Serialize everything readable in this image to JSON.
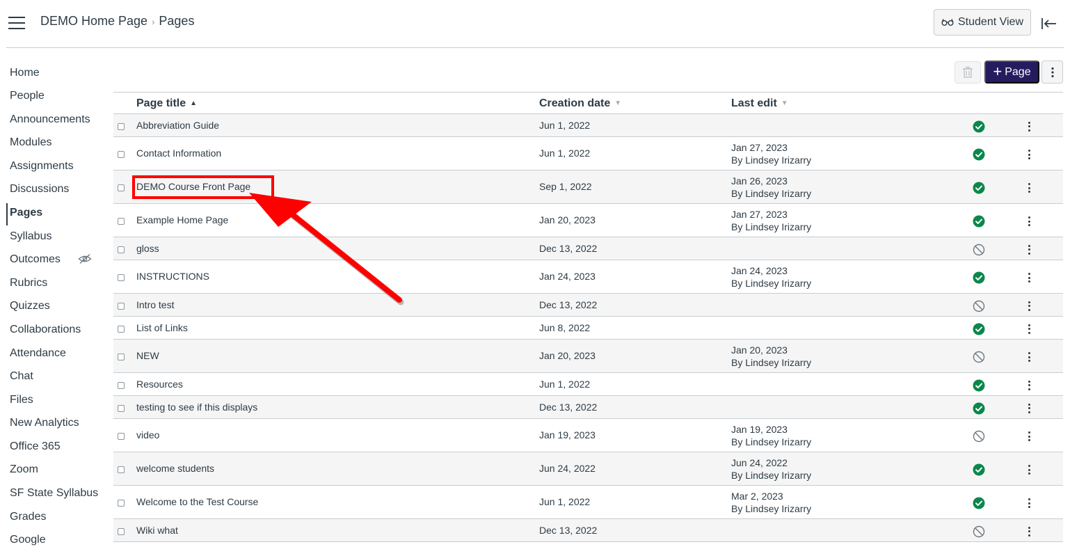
{
  "header": {
    "breadcrumb": {
      "course": "DEMO Home Page",
      "separator": "›",
      "page": "Pages"
    },
    "student_view_label": "Student View"
  },
  "sidebar": {
    "items": [
      {
        "label": "Home"
      },
      {
        "label": "People"
      },
      {
        "label": "Announcements"
      },
      {
        "label": "Modules"
      },
      {
        "label": "Assignments"
      },
      {
        "label": "Discussions"
      },
      {
        "label": "Pages",
        "active": true
      },
      {
        "label": "Syllabus"
      },
      {
        "label": "Outcomes",
        "hidden_icon": "eye-off-icon"
      },
      {
        "label": "Rubrics"
      },
      {
        "label": "Quizzes"
      },
      {
        "label": "Collaborations"
      },
      {
        "label": "Attendance"
      },
      {
        "label": "Chat"
      },
      {
        "label": "Files"
      },
      {
        "label": "New Analytics"
      },
      {
        "label": "Office 365"
      },
      {
        "label": "Zoom"
      },
      {
        "label": "SF State Syllabus"
      },
      {
        "label": "Grades"
      },
      {
        "label": "Google"
      }
    ]
  },
  "toolbar": {
    "add_page_plus": "+",
    "add_page_label": "Page"
  },
  "table": {
    "columns": {
      "title": "Page title",
      "created": "Creation date",
      "last_edit": "Last edit"
    },
    "sort_up": "▲",
    "sort_down": "▼",
    "rows": [
      {
        "title": "Abbreviation Guide",
        "created": "Jun 1, 2022",
        "edit_date": "",
        "edit_by": "",
        "published": true
      },
      {
        "title": "Contact Information",
        "created": "Jun 1, 2022",
        "edit_date": "Jan 27, 2023",
        "edit_by": "By Lindsey Irizarry",
        "published": true
      },
      {
        "title": "DEMO Course Front Page",
        "created": "Sep 1, 2022",
        "edit_date": "Jan 26, 2023",
        "edit_by": "By Lindsey Irizarry",
        "published": true
      },
      {
        "title": "Example Home Page",
        "created": "Jan 20, 2023",
        "edit_date": "Jan 27, 2023",
        "edit_by": "By Lindsey Irizarry",
        "published": true
      },
      {
        "title": "gloss",
        "created": "Dec 13, 2022",
        "edit_date": "",
        "edit_by": "",
        "published": false
      },
      {
        "title": "INSTRUCTIONS",
        "created": "Jan 24, 2023",
        "edit_date": "Jan 24, 2023",
        "edit_by": "By Lindsey Irizarry",
        "published": true
      },
      {
        "title": "Intro test",
        "created": "Dec 13, 2022",
        "edit_date": "",
        "edit_by": "",
        "published": false
      },
      {
        "title": "List of Links",
        "created": "Jun 8, 2022",
        "edit_date": "",
        "edit_by": "",
        "published": true
      },
      {
        "title": "NEW",
        "created": "Jan 20, 2023",
        "edit_date": "Jan 20, 2023",
        "edit_by": "By Lindsey Irizarry",
        "published": false
      },
      {
        "title": "Resources",
        "created": "Jun 1, 2022",
        "edit_date": "",
        "edit_by": "",
        "published": true
      },
      {
        "title": "testing to see if this displays",
        "created": "Dec 13, 2022",
        "edit_date": "",
        "edit_by": "",
        "published": true
      },
      {
        "title": "video",
        "created": "Jan 19, 2023",
        "edit_date": "Jan 19, 2023",
        "edit_by": "By Lindsey Irizarry",
        "published": false
      },
      {
        "title": "welcome students",
        "created": "Jun 24, 2022",
        "edit_date": "Jun 24, 2022",
        "edit_by": "By Lindsey Irizarry",
        "published": true
      },
      {
        "title": "Welcome to the Test Course",
        "created": "Jun 1, 2022",
        "edit_date": "Mar 2, 2023",
        "edit_by": "By Lindsey Irizarry",
        "published": true
      },
      {
        "title": "Wiki what",
        "created": "Dec 13, 2022",
        "edit_date": "",
        "edit_by": "",
        "published": false
      }
    ]
  },
  "colors": {
    "primary_button": "#241c5e",
    "published": "#0b874b",
    "unpublished": "#6b7780",
    "annotation": "#ff0000",
    "text": "#2d3b45"
  }
}
